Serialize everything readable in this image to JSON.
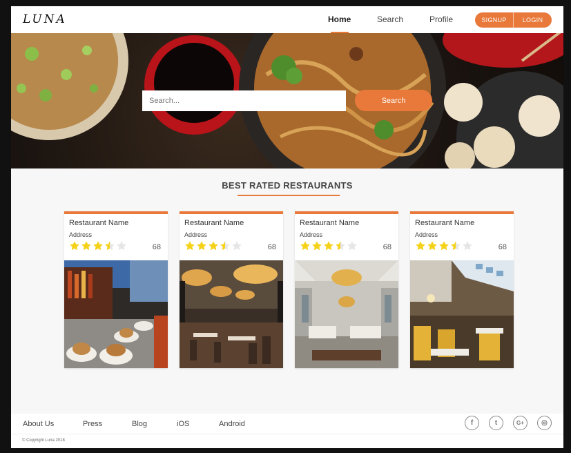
{
  "brand": {
    "logo": "LUNA",
    "accent": "#e8793a"
  },
  "nav": {
    "items": [
      {
        "label": "Home",
        "active": true
      },
      {
        "label": "Search",
        "active": false
      },
      {
        "label": "Profile",
        "active": false
      }
    ],
    "signup_label": "SIGNUP",
    "login_label": "LOGIN"
  },
  "hero": {
    "search_placeholder": "Search...",
    "search_button": "Search"
  },
  "section": {
    "title": "BEST RATED RESTAURANTS"
  },
  "restaurants": [
    {
      "name": "Restaurant Name",
      "address": "Address",
      "rating": 3.5,
      "max_rating": 5,
      "count": "68",
      "image": "bar-counter-with-burgers"
    },
    {
      "name": "Restaurant Name",
      "address": "Address",
      "rating": 3.5,
      "max_rating": 5,
      "count": "68",
      "image": "dining-hall-with-chandeliers"
    },
    {
      "name": "Restaurant Name",
      "address": "Address",
      "rating": 3.5,
      "max_rating": 5,
      "count": "68",
      "image": "elegant-room-with-chandelier"
    },
    {
      "name": "Restaurant Name",
      "address": "Address",
      "rating": 3.5,
      "max_rating": 5,
      "count": "68",
      "image": "dining-room-with-skylight"
    }
  ],
  "footer": {
    "links": [
      "About Us",
      "Press",
      "Blog",
      "iOS",
      "Android"
    ],
    "social": [
      {
        "icon": "facebook-icon",
        "glyph": "f"
      },
      {
        "icon": "twitter-icon",
        "glyph": "t"
      },
      {
        "icon": "google-plus-icon",
        "glyph": "G+"
      },
      {
        "icon": "instagram-icon",
        "glyph": "◎"
      }
    ],
    "copyright": "© Copyright Luna 2018"
  }
}
